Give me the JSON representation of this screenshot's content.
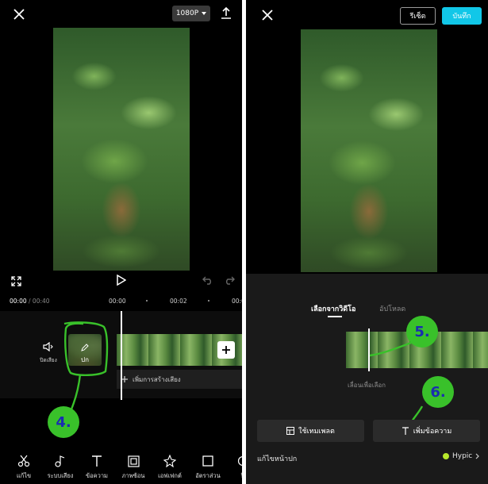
{
  "left": {
    "resolution_label": "1080P",
    "time_current": "00:00",
    "time_total": "/ 00:40",
    "ruler_marks": [
      "00:00",
      "00:02",
      "00:0"
    ],
    "mute_label": "ปิดเสียง",
    "cover_label": "ปก",
    "add_audio_label": "เพิ่มการสร้างเสียง",
    "step_badge": "4.",
    "toolbar": [
      {
        "label": "แก้ไข",
        "icon": "scissors-icon"
      },
      {
        "label": "ระบบเสียง",
        "icon": "music-note-icon"
      },
      {
        "label": "ข้อความ",
        "icon": "text-icon"
      },
      {
        "label": "ภาพซ้อน",
        "icon": "overlay-icon"
      },
      {
        "label": "เอฟเฟกต์",
        "icon": "effects-star-icon"
      },
      {
        "label": "อัตราส่วน",
        "icon": "aspect-ratio-icon"
      },
      {
        "label": "ฟิ",
        "icon": "filter-icon"
      }
    ]
  },
  "right": {
    "reset_label": "รีเซ็ต",
    "save_label": "บันทึก",
    "tabs": [
      {
        "label": "เลือกจากวิดีโอ",
        "active": true
      },
      {
        "label": "อัปโหลด",
        "active": false
      }
    ],
    "slide_hint": "เลื่อนเพื่อเลือก",
    "template_button": "ใช้เทมเพลต",
    "add_text_button": "เพิ่มข้อความ",
    "edit_cover_label": "แก้ไขหน้าปก",
    "hypic_label": "Hypic",
    "step_badge_5": "5.",
    "step_badge_6": "6."
  },
  "colors": {
    "accent_cyan": "#11c7e8",
    "annotation_green": "#39c12a",
    "badge_text_blue": "#1a2db0"
  }
}
